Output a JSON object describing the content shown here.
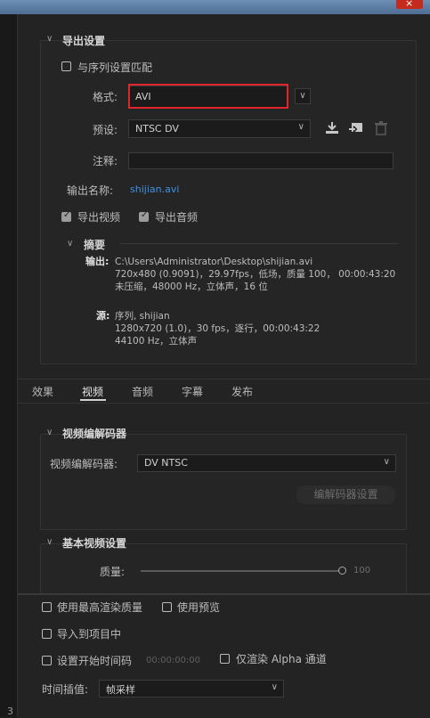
{
  "window": {
    "close_icon": "×"
  },
  "export_settings": {
    "section_title": "导出设置",
    "match_sequence_label": "与序列设置匹配",
    "format_label": "格式:",
    "format_value": "AVI",
    "preset_label": "预设:",
    "preset_value": "NTSC DV",
    "comment_label": "注释:",
    "comment_value": "",
    "output_name_label": "输出名称:",
    "output_name_value": "shijian.avi",
    "export_video_label": "导出视频",
    "export_video_checked": true,
    "export_audio_label": "导出音频",
    "export_audio_checked": true
  },
  "summary": {
    "title": "摘要",
    "output_label": "输出:",
    "output_path": "C:\\Users\\Administrator\\Desktop\\shijian.avi",
    "output_line2": "720x480 (0.9091)，29.97fps，低场，质量 100，  00:00:43:20",
    "output_line3": "未压缩，48000 Hz，立体声，16 位",
    "source_label": "源:",
    "source_line1": "序列, shijian",
    "source_line2": "1280x720 (1.0)，30 fps，逐行，00:00:43:22",
    "source_line3": "44100 Hz，立体声"
  },
  "tabs": [
    {
      "label": "效果",
      "active": false
    },
    {
      "label": "视频",
      "active": true
    },
    {
      "label": "音频",
      "active": false
    },
    {
      "label": "字幕",
      "active": false
    },
    {
      "label": "发布",
      "active": false
    }
  ],
  "video_codec": {
    "section_title": "视频编解码器",
    "codec_label": "视频编解码器:",
    "codec_value": "DV NTSC",
    "codec_settings_button": "编解码器设置"
  },
  "basic_video": {
    "section_title": "基本视频设置",
    "quality_label": "质量:",
    "quality_value": "100",
    "quality_fraction": 1.0
  },
  "bottom": {
    "max_render_quality_label": "使用最高渲染质量",
    "use_previews_label": "使用预览",
    "import_into_project_label": "导入到项目中",
    "set_start_timecode_label": "设置开始时间码",
    "start_timecode_value": "00:00:00:00",
    "render_alpha_only_label": "仅渲染 Alpha 通道",
    "time_interpolation_label": "时间插值:",
    "time_interpolation_value": "帧采样"
  },
  "left_edge_glyph": "3"
}
